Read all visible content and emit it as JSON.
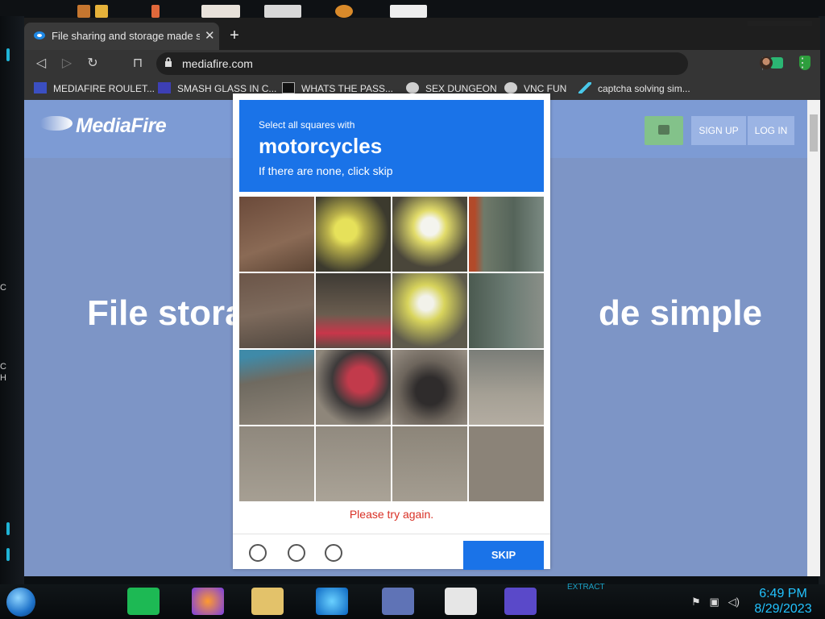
{
  "browser": {
    "tab_title": "File sharing and storage made simple",
    "tab_close": "✕",
    "new_tab": "+",
    "url": "mediafire.com",
    "menu": "⋮"
  },
  "bookmarks": [
    {
      "label": "MEDIAFIRE ROULET...",
      "icon": "mft-icon"
    },
    {
      "label": "SMASH GLASS IN C...",
      "icon": "sigma-icon"
    },
    {
      "label": "WHATS THE PASS...",
      "icon": "lock-icon"
    },
    {
      "label": "SEX DUNGEON",
      "icon": "skull-icon"
    },
    {
      "label": "VNC FUN",
      "icon": "skull-icon"
    },
    {
      "label": "captcha solving sim...",
      "icon": "lambda-icon"
    }
  ],
  "mediafire": {
    "logo": "MediaFire",
    "signup": "SIGN UP",
    "login": "LOG IN",
    "hero_left": "File storag",
    "hero_right": "de simple"
  },
  "captcha": {
    "instruction": "Select all squares with",
    "target": "motorcycles",
    "hint": "If there are none, click skip",
    "error": "Please try again.",
    "skip": "SKIP"
  },
  "taskbar": {
    "time": "6:49 PM",
    "date": "8/29/2023",
    "extract": "EXTRACT"
  },
  "desktop_edge_text": [
    "C",
    "",
    "",
    "",
    "",
    "",
    "C",
    "H"
  ],
  "colors": {
    "captcha_blue": "#1a73e8",
    "error_red": "#d93025",
    "page_bg": "#7d95c6",
    "clock": "#22c3ff"
  }
}
